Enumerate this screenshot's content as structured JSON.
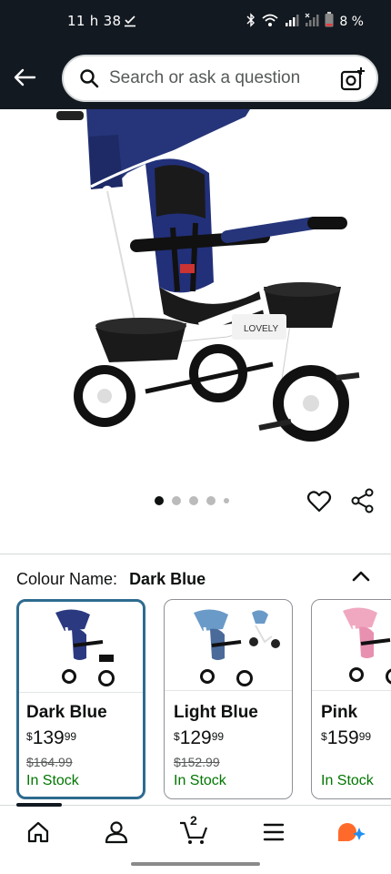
{
  "status_bar": {
    "time": "11 h 38",
    "battery": "8 %"
  },
  "header": {
    "search_placeholder": "Search or ask a question"
  },
  "product_image": {
    "brand_text": "LOVELY"
  },
  "carousel": {
    "dot_count": 5,
    "active_index": 0
  },
  "variation": {
    "label": "Colour Name:",
    "selected": "Dark Blue"
  },
  "swatches": [
    {
      "name": "Dark Blue",
      "currency": "$",
      "whole": "139",
      "fraction": "99",
      "old_price": "$164.99",
      "stock": "In Stock",
      "selected": true,
      "color": "#2b3a80"
    },
    {
      "name": "Light Blue",
      "currency": "$",
      "whole": "129",
      "fraction": "99",
      "old_price": "$152.99",
      "stock": "In Stock",
      "selected": false,
      "color": "#6a9ac8"
    },
    {
      "name": "Pink",
      "currency": "$",
      "whole": "159",
      "fraction": "99",
      "old_price": "",
      "stock": "In Stock",
      "selected": false,
      "color": "#f0a8c0"
    }
  ],
  "bottom_nav": {
    "cart_count": "2",
    "items": [
      "home-icon",
      "account-icon",
      "cart-icon",
      "menu-icon",
      "rufus-icon"
    ]
  },
  "colors": {
    "header_bg": "#131921",
    "stock_green": "#007600",
    "selected_border": "#2e6b8f",
    "rufus_orange": "#ff6a2b",
    "rufus_blue": "#1f8ef1"
  }
}
